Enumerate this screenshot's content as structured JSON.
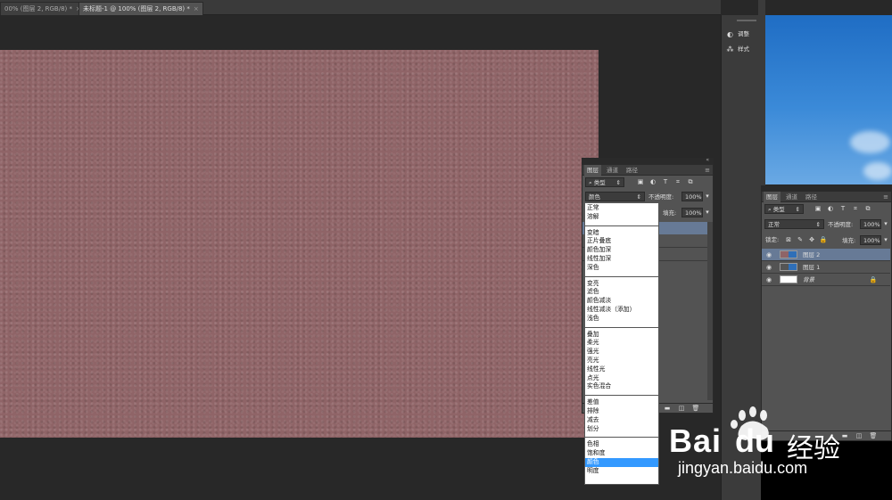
{
  "tabs": [
    {
      "label": "00% (图层 2, RGB/8) *",
      "close": "×"
    },
    {
      "label": "未标题-1 @ 100% (图层 2, RGB/8) *",
      "close": "×"
    }
  ],
  "dock": {
    "items": [
      {
        "label": "调整",
        "icon": "adjustments-icon"
      },
      {
        "label": "样式",
        "icon": "styles-icon"
      }
    ]
  },
  "mid_panel": {
    "tabs": [
      "图层",
      "通道",
      "路径"
    ],
    "kind_label": "类型",
    "blend_value": "颜色",
    "opacity_label": "不透明度:",
    "opacity_value": "100%",
    "fill_label": "填充:",
    "fill_value": "100%"
  },
  "right_panel": {
    "tabs": [
      "图层",
      "通道",
      "路径"
    ],
    "kind_label": "类型",
    "blend_value": "正常",
    "opacity_label": "不透明度:",
    "opacity_value": "100%",
    "lock_label": "锁定:",
    "fill_label": "填充:",
    "fill_value": "100%",
    "layers": [
      {
        "name": "图层 2",
        "selected": true
      },
      {
        "name": "图层 1",
        "selected": false
      },
      {
        "name": "背景",
        "selected": false
      }
    ]
  },
  "blend_menu": {
    "groups": [
      [
        "正常",
        "溶解"
      ],
      [
        "变暗",
        "正片叠底",
        "颜色加深",
        "线性加深",
        "深色"
      ],
      [
        "变亮",
        "滤色",
        "颜色减淡",
        "线性减淡（添加）",
        "浅色"
      ],
      [
        "叠加",
        "柔光",
        "强光",
        "亮光",
        "线性光",
        "点光",
        "实色混合"
      ],
      [
        "差值",
        "排除",
        "减去",
        "划分"
      ],
      [
        "色相",
        "饱和度",
        "颜色",
        "明度"
      ]
    ],
    "selected": "颜色"
  },
  "watermark": {
    "brand": "Bai",
    "brand2": "du",
    "cn": "经验",
    "url": "jingyan.baidu.com"
  },
  "colors": {
    "canvas": "#8f6467",
    "accent": "#3399ff",
    "layer_selected": "#677a96"
  }
}
